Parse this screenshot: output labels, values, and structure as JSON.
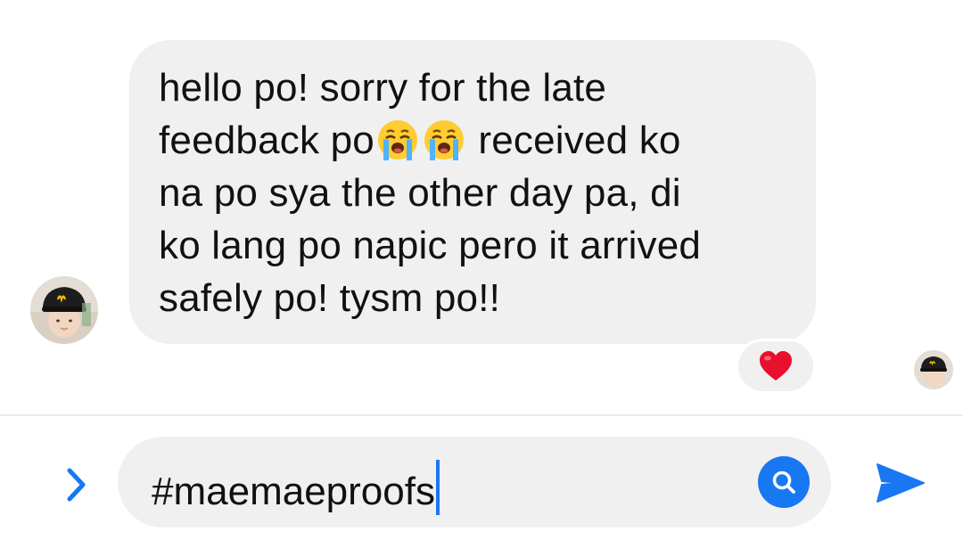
{
  "conversation": {
    "message": {
      "text_line1": "hello po! sorry for the late",
      "text_line2a": "feedback po",
      "text_line2b": " received ko",
      "text_line3": "na po sya the other day pa, di",
      "text_line4": "ko lang po napic pero it arrived",
      "text_line5": "safely po! tysm po!!",
      "emojis": [
        "loudly-crying-face-emoji",
        "loudly-crying-face-emoji"
      ],
      "reaction": "heart-emoji"
    },
    "sender_avatar": "avatar",
    "seen_avatar": "seen-avatar"
  },
  "composer": {
    "value": "#maemaeproofs",
    "expand_icon": "chevron-right-icon",
    "search_icon": "search-icon",
    "send_icon": "send-icon"
  },
  "colors": {
    "accent": "#1877f2",
    "bubble": "#f0f0f0",
    "text": "#111111",
    "heart": "#e8112d"
  }
}
